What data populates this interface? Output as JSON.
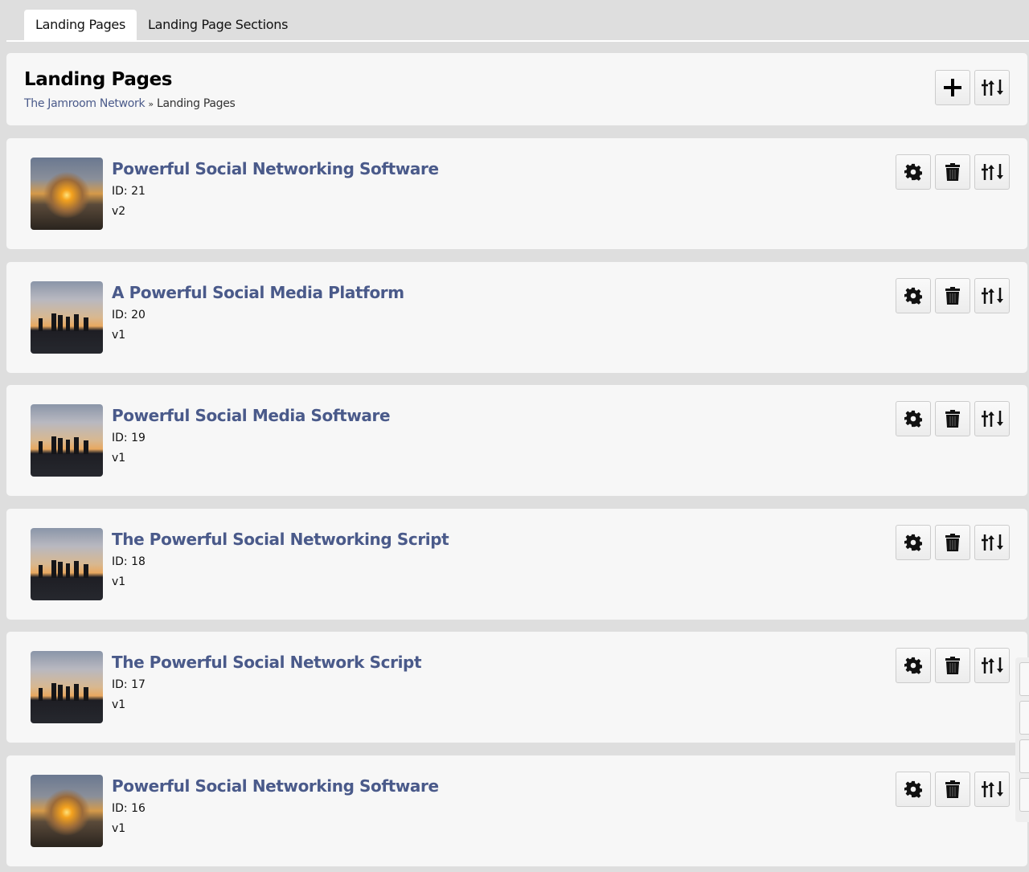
{
  "tabs": [
    {
      "label": "Landing Pages",
      "active": true
    },
    {
      "label": "Landing Page Sections",
      "active": false
    }
  ],
  "header": {
    "title": "Landing Pages",
    "breadcrumb": {
      "root": "The Jamroom Network",
      "separator": "»",
      "current": "Landing Pages"
    },
    "buttons": [
      "plus-icon",
      "sliders-icon"
    ]
  },
  "colors": {
    "link": "#4a5a8a",
    "background": "#dedede",
    "card": "#f7f7f7"
  },
  "items": [
    {
      "title": "Powerful Social Networking Software",
      "id": "ID: 21",
      "version": "v2",
      "thumb": "sunset"
    },
    {
      "title": "A Powerful Social Media Platform",
      "id": "ID: 20",
      "version": "v1",
      "thumb": "group"
    },
    {
      "title": "Powerful Social Media Software",
      "id": "ID: 19",
      "version": "v1",
      "thumb": "group"
    },
    {
      "title": "The Powerful Social Networking Script",
      "id": "ID: 18",
      "version": "v1",
      "thumb": "group"
    },
    {
      "title": "The Powerful Social Network Script",
      "id": "ID: 17",
      "version": "v1",
      "thumb": "group"
    },
    {
      "title": "Powerful Social Networking Software",
      "id": "ID: 16",
      "version": "v1",
      "thumb": "sunset"
    }
  ]
}
